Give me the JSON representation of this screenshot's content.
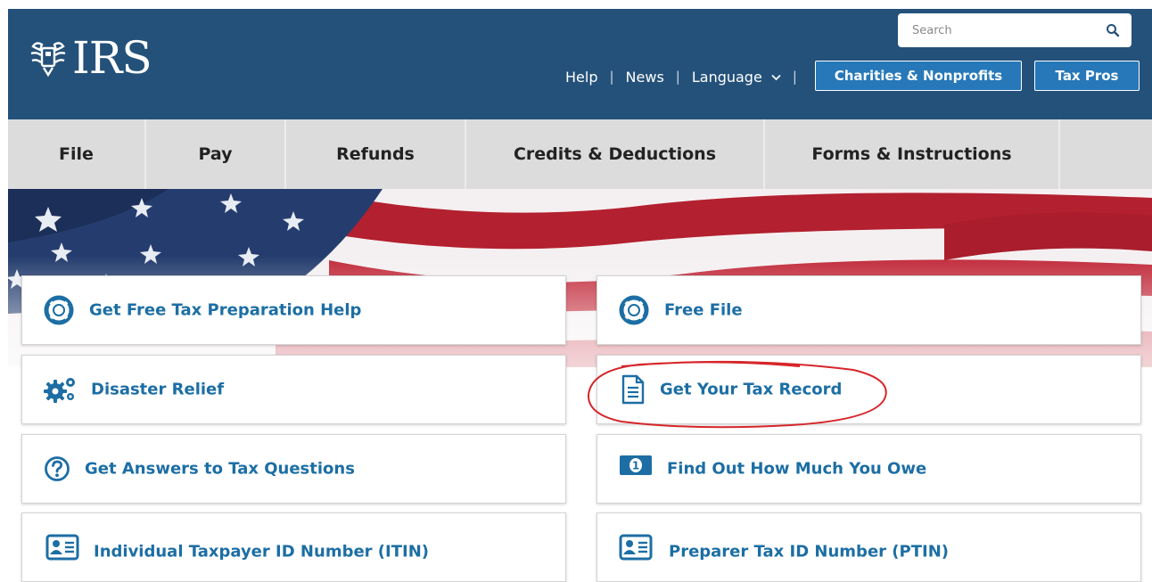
{
  "header": {
    "logo_text": "IRS",
    "search_placeholder": "Search",
    "links": {
      "help": "Help",
      "news": "News",
      "language": "Language"
    },
    "separator": "|",
    "buttons": {
      "charities": "Charities & Nonprofits",
      "tax_pros": "Tax Pros"
    }
  },
  "nav": {
    "items": [
      "File",
      "Pay",
      "Refunds",
      "Credits & Deductions",
      "Forms & Instructions"
    ]
  },
  "cards": {
    "left": [
      {
        "label": "Get Free Tax Preparation Help",
        "icon": "lifebuoy-icon"
      },
      {
        "label": "Disaster Relief",
        "icon": "gears-icon"
      },
      {
        "label": "Get Answers to Tax Questions",
        "icon": "question-circle-icon"
      },
      {
        "label": "Individual Taxpayer ID Number (ITIN)",
        "icon": "id-card-icon"
      }
    ],
    "right": [
      {
        "label": "Free File",
        "icon": "lifebuoy-icon"
      },
      {
        "label": "Get Your Tax Record",
        "icon": "document-icon"
      },
      {
        "label": "Find Out How Much You Owe",
        "icon": "money-icon"
      },
      {
        "label": "Preparer Tax ID Number (PTIN)",
        "icon": "id-card-icon"
      }
    ]
  },
  "colors": {
    "header_bg": "#24517a",
    "nav_bg": "#dcdcdc",
    "button_bg": "#2678b9",
    "card_label": "#1c6ea4",
    "annotation": "#d6262a"
  }
}
